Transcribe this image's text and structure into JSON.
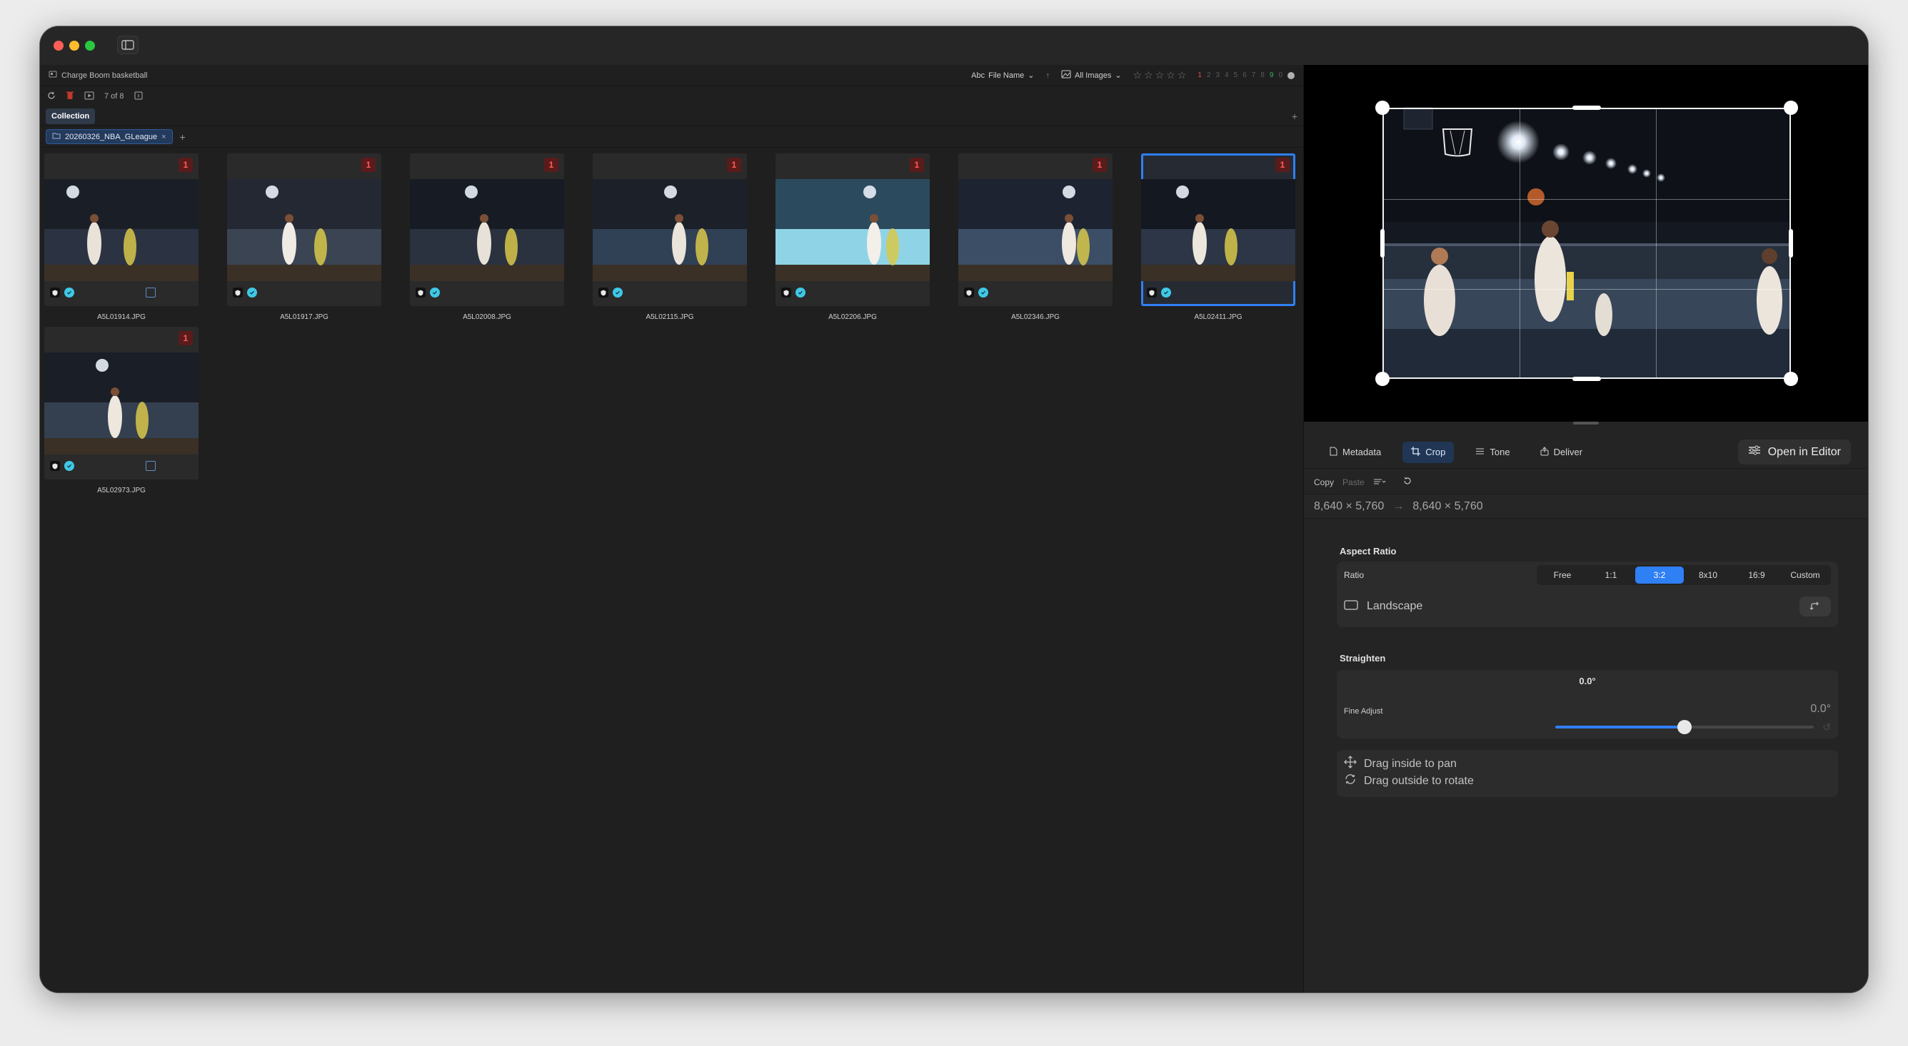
{
  "window": {
    "collection_name": "Charge Boom basketball",
    "count_text": "7 of 8"
  },
  "toolbar": {
    "sort_prefix": "Abc",
    "sort_label": "File Name",
    "sort_direction": "↑",
    "filter_label": "All Images",
    "stars": [
      "☆",
      "☆",
      "☆",
      "☆",
      "☆"
    ],
    "color_numbers": [
      "1",
      "2",
      "3",
      "4",
      "5",
      "6",
      "7",
      "8",
      "9",
      "0"
    ]
  },
  "collection_tab": "Collection",
  "tag": {
    "label": "20260326_NBA_GLeague",
    "close": "×",
    "add": "+"
  },
  "grid": {
    "items": [
      {
        "file": "A5L01914.JPG",
        "rating": "1",
        "selected": false
      },
      {
        "file": "A5L01917.JPG",
        "rating": "1",
        "selected": false
      },
      {
        "file": "A5L02008.JPG",
        "rating": "1",
        "selected": false
      },
      {
        "file": "A5L02115.JPG",
        "rating": "1",
        "selected": false
      },
      {
        "file": "A5L02206.JPG",
        "rating": "1",
        "selected": false
      },
      {
        "file": "A5L02346.JPG",
        "rating": "1",
        "selected": false
      },
      {
        "file": "A5L02411.JPG",
        "rating": "1",
        "selected": true
      },
      {
        "file": "A5L02973.JPG",
        "rating": "1",
        "selected": false
      }
    ]
  },
  "panel": {
    "tabs": [
      {
        "label": "Metadata",
        "icon": "doc-icon"
      },
      {
        "label": "Crop",
        "icon": "crop-icon"
      },
      {
        "label": "Tone",
        "icon": "lines-icon"
      },
      {
        "label": "Deliver",
        "icon": "share-icon"
      }
    ],
    "open_editor": "Open in Editor",
    "copy": "Copy",
    "paste": "Paste",
    "dim_from": "8,640 × 5,760",
    "dim_arrow": "→",
    "dim_to": "8,640 × 5,760"
  },
  "crop": {
    "aspect_title": "Aspect Ratio",
    "ratio_label": "Ratio",
    "ratios": [
      "Free",
      "1:1",
      "3:2",
      "8x10",
      "16:9",
      "Custom"
    ],
    "selected_ratio": "3:2",
    "landscape_label": "Landscape",
    "straighten_title": "Straighten",
    "straighten_value": "0.0°",
    "fine_adjust_label": "Fine Adjust",
    "fine_adjust_value": "0.0°",
    "fine_adjust_position": 0.5,
    "hint_pan": "Drag inside to pan",
    "hint_rotate": "Drag outside to rotate"
  },
  "colors": {
    "accent": "#2f7ff5",
    "badge": "#ff5c5c",
    "background": "#1f1f1f"
  }
}
